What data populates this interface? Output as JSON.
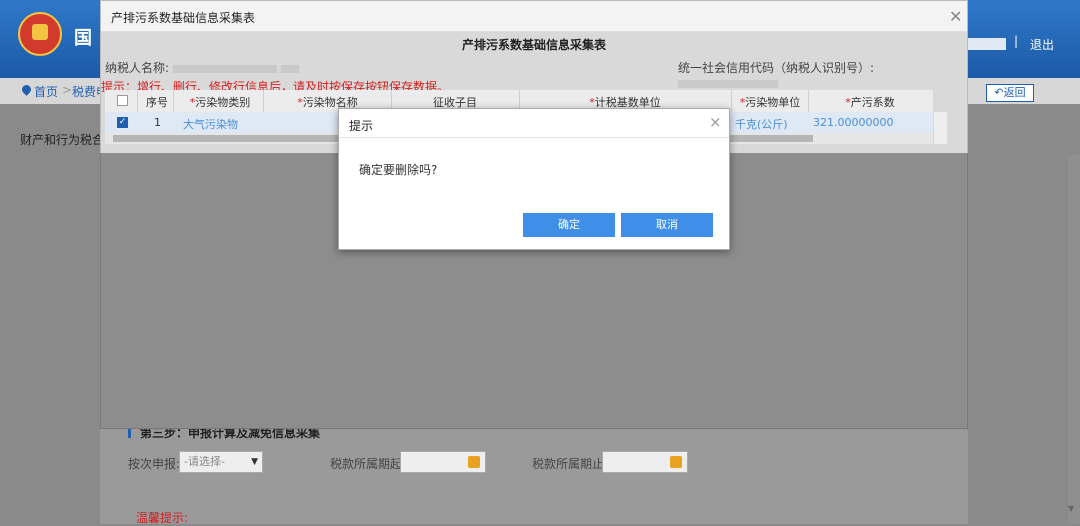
{
  "header": {
    "brand": "国",
    "logout": "退出",
    "separator": "|"
  },
  "breadcrumb": {
    "home": "首页",
    "sep": ">",
    "tax": "税费申"
  },
  "return_button": "返回",
  "side_title": "财产和行为税合并",
  "step": {
    "title": "第三步：申报计算及减免信息采集",
    "declare_label": "按次申报:",
    "declare_placeholder": "-请选择-",
    "start_label": "税款所属期起:",
    "end_label": "税款所属期止:",
    "warm_tip": "温馨提示:"
  },
  "modal": {
    "title": "产排污系数基础信息采集表",
    "form_title": "产排污系数基础信息采集表",
    "taxpayer_label": "纳税人名称:",
    "credit_label": "统一社会信用代码（纳税人识别号）:",
    "tip": "提示：增行、删行、修改行信息后，请及时按保存按钮保存数据。",
    "columns": [
      {
        "label": "序号",
        "required": false
      },
      {
        "label": "污染物类别",
        "required": true
      },
      {
        "label": "污染物名称",
        "required": true
      },
      {
        "label": "征收子目",
        "required": false
      },
      {
        "label": "计税基数单位",
        "required": true
      },
      {
        "label": "污染物单位",
        "required": true
      },
      {
        "label": "产污系数",
        "required": true
      }
    ],
    "rows": [
      {
        "index": "1",
        "category": "大气污染物",
        "pollutant_unit": "千克(公斤)",
        "coefficient": "321.00000000"
      }
    ]
  },
  "dialog": {
    "title": "提示",
    "message": "确定要删除吗?",
    "ok": "确定",
    "cancel": "取消",
    "close": "×"
  },
  "colors": {
    "primary": "#3f8fe8",
    "warning": "#d21e1e",
    "header": "#1c5aa8"
  },
  "icons": [
    "close-icon",
    "home-icon",
    "calendar-icon",
    "checkbox-icon",
    "dropdown-arrow-icon"
  ]
}
